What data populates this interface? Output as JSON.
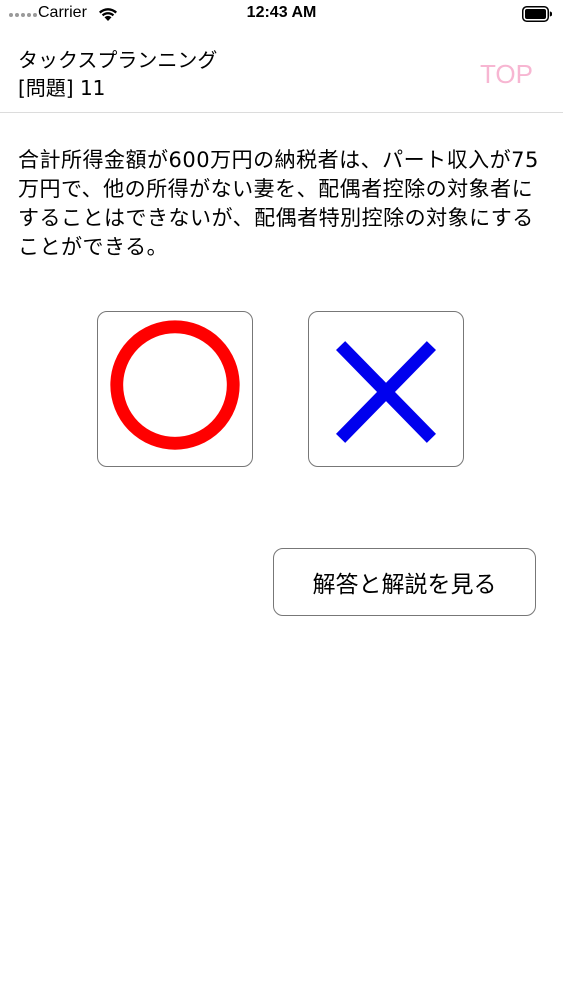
{
  "status_bar": {
    "carrier": "Carrier",
    "time": "12:43 AM"
  },
  "header": {
    "title": "タックスプランニング",
    "question_number": "[問題] 11",
    "top_link": "TOP"
  },
  "question": {
    "text": "合計所得金額が600万円の納税者は、パート収入が75万円で、他の所得がない妻を、配偶者控除の対象者にすることはできないが、配偶者特別控除の対象にすることができる。"
  },
  "answers": [
    {
      "symbol": "circle-icon",
      "color": "#ff0000"
    },
    {
      "symbol": "cross-icon",
      "color": "#0000ee"
    }
  ],
  "explain_button": {
    "label": "解答と解説を見る"
  },
  "colors": {
    "top_link": "#f7b6d2",
    "circle": "#ff0000",
    "cross": "#0000ee"
  }
}
